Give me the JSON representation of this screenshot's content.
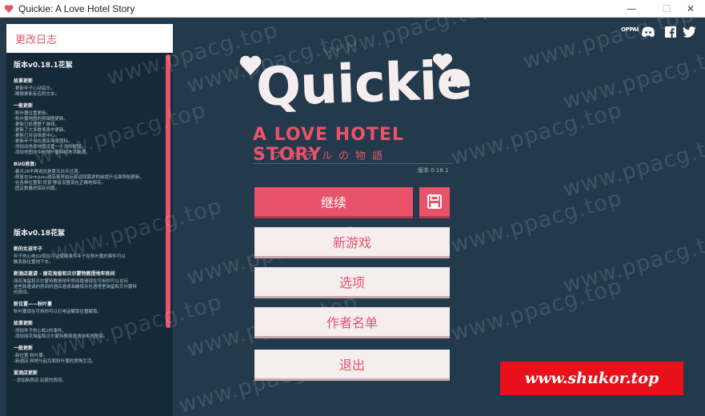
{
  "window": {
    "title": "Quickie: A Love Hotel Story",
    "controls": {
      "minimize": "—",
      "maximize": "☐",
      "close": "✕"
    }
  },
  "changelog": {
    "header": "更改日志",
    "sections": [
      {
        "version": "版本v0.18.1花絮",
        "groups": [
          {
            "title": "故事更新",
            "lines": [
              "-更新年子心动音乐。",
              "-略微更新反应的文本。"
            ]
          },
          {
            "title": "一般更新",
            "lines": [
              "-秋叶蔓位置更新。",
              "-秋叶蔓地图的剪辑图更新。",
              "-更新已处理整个游戏。",
              "-更新了大多数场景中更新。",
              "-更新已对话场景中心。",
              "-更新年子母在酒店场景图标。",
              "-添加动场景地图设置一个次的按钮。",
              "-添加地图块中的秋叶蔓特权地平面通。"
            ]
          },
          {
            "title": "BUG修复:",
            "lines": [
              "-春天28不再说这是夏天白天过渡。",
              "-修复在Shinjuku酒店客房给玩家返回需求的前提升见面导航更新。",
              "-在各种位置和'背景'静音设置现在正确地保存。",
              "-固定数量的保存问题。"
            ]
          }
        ]
      },
      {
        "version": "版本v0.18花絮",
        "groups": [
          {
            "title": "新的女孩年子",
            "lines": [
              "年子的心电Q2现在可以使用事件年子在秋叶蔓的事件可以",
              "触发新位置地下车。"
            ]
          },
          {
            "title": "新酒店邀请 - 丽花淘留和贝尔蒙特教授地牢房间",
            "lines": [
              "丽花淘留和贝尔蒙特教授地牢房间邀请现在可用你可以访问",
              "这些新邀请的房间的酒店邀请准确保存在酒馆里淘留和贝尔蒙特",
              "的房间。"
            ]
          },
          {
            "title": "新位置——秋叶蔓",
            "lines": [
              "秋叶蔓现在可用你可以打电话解锁位置解锁。"
            ]
          },
          {
            "title": "故事更新",
            "lines": [
              "-添加年子的心和2的事件。",
              "-添加丽花淘留和贝尔蒙特教授邀请地牢的房间。"
            ]
          },
          {
            "title": "一般更新",
            "lines": [
              "-新位置 秋叶蔓。",
              "-新酒店 网吧与起鸟和秋叶蔓的爱情生活。"
            ]
          },
          {
            "title": "爱酒店更新",
            "lines": [
              "- 添加新房间 玩家的房间。"
            ]
          }
        ]
      }
    ]
  },
  "social": {
    "oppai_label": "OPPAI",
    "icons": [
      "oppai-icon",
      "discord-icon",
      "facebook-icon",
      "twitter-icon"
    ]
  },
  "logo": {
    "title": "Quickie",
    "subtitle": "A LOVE HOTEL STORY",
    "japanese": "ラブホテルの物語",
    "version": "版本 0.18.1"
  },
  "menu": {
    "continue": "继续",
    "new_game": "新游戏",
    "options": "选项",
    "credits": "作者名单",
    "quit": "退出",
    "save_icon": "save-icon"
  },
  "watermark": {
    "text": "www.ppacg.top",
    "banner": "www.shukor.top"
  },
  "colors": {
    "accent": "#e8526a",
    "background": "#223a4b",
    "panel": "#142a39",
    "button": "#f6eeee",
    "banner": "#e8111b"
  }
}
